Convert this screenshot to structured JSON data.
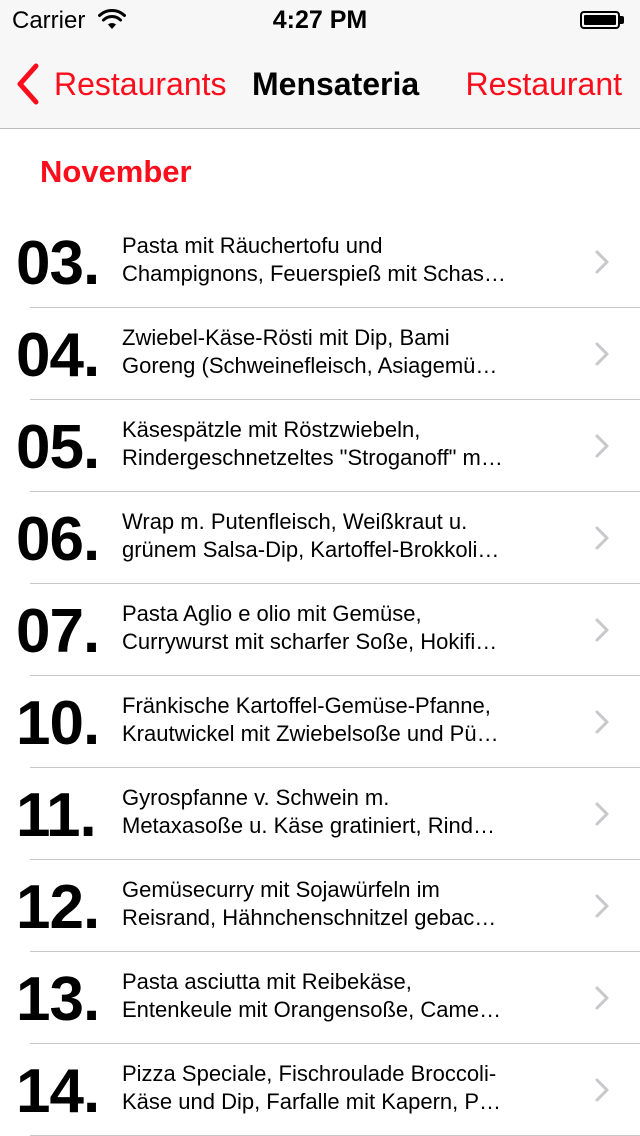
{
  "status_bar": {
    "carrier": "Carrier",
    "time": "4:27 PM"
  },
  "nav": {
    "back_label": "Restaurants",
    "title": "Mensateria",
    "right_label": "Restaurant"
  },
  "accent_color": "#fc0d1b",
  "section": {
    "title": "November"
  },
  "rows": [
    {
      "day": "03.",
      "line1": "Pasta mit Räuchertofu und",
      "line2": "Champignons, Feuerspieß mit Schas…"
    },
    {
      "day": "04.",
      "line1": "Zwiebel-Käse-Rösti  mit Dip, Bami",
      "line2": "Goreng (Schweinefleisch, Asiagemü…"
    },
    {
      "day": "05.",
      "line1": "Käsespätzle mit Röstzwiebeln,",
      "line2": "Rindergeschnetzeltes \"Stroganoff\" m…"
    },
    {
      "day": "06.",
      "line1": "Wrap m. Putenfleisch, Weißkraut  u.",
      "line2": "grünem Salsa-Dip, Kartoffel-Brokkoli…"
    },
    {
      "day": "07.",
      "line1": "Pasta Aglio e olio mit Gemüse,",
      "line2": "Currywurst  mit scharfer Soße, Hokifi…"
    },
    {
      "day": "10.",
      "line1": "Fränkische Kartoffel-Gemüse-Pfanne,",
      "line2": "Krautwickel mit Zwiebelsoße und Pü…"
    },
    {
      "day": "11.",
      "line1": "Gyrospfanne v. Schwein m.",
      "line2": "Metaxasoße u. Käse  gratiniert, Rind…"
    },
    {
      "day": "12.",
      "line1": "Gemüsecurry mit Sojawürfeln im",
      "line2": "Reisrand, Hähnchenschnitzel gebac…"
    },
    {
      "day": "13.",
      "line1": "Pasta asciutta mit Reibekäse,",
      "line2": "Entenkeule mit Orangensoße, Came…"
    },
    {
      "day": "14.",
      "line1": "Pizza Speciale, Fischroulade Broccoli-",
      "line2": "Käse und Dip, Farfalle mit Kapern, P…"
    }
  ]
}
